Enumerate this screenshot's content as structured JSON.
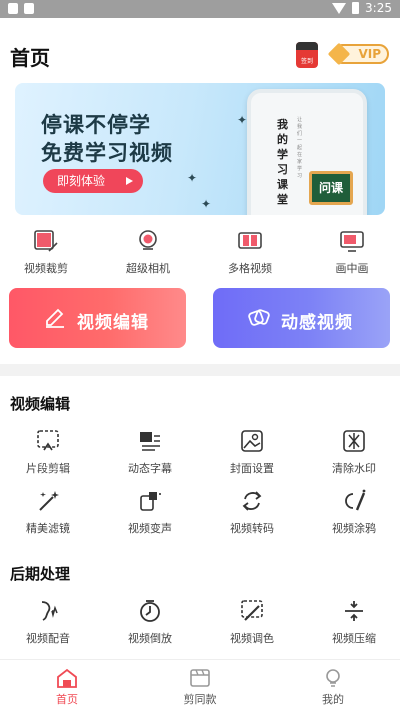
{
  "status_bar": {
    "time": "3:25"
  },
  "header": {
    "title": "首页",
    "sign_label": "签到",
    "vip_label": "VIP"
  },
  "banner": {
    "headline": "停课不停学",
    "subline": "免费学习视频",
    "cta": "即刻体验",
    "phone_text": "我的学习课堂",
    "phone_sub": "让我们一起在家学习",
    "board_text": "问课"
  },
  "features": [
    {
      "label": "视频裁剪",
      "icon": "crop-icon"
    },
    {
      "label": "超级相机",
      "icon": "camera-icon"
    },
    {
      "label": "多格视频",
      "icon": "grid-video-icon"
    },
    {
      "label": "画中画",
      "icon": "picture-in-picture-icon"
    }
  ],
  "big_buttons": {
    "edit": {
      "label": "视频编辑",
      "icon": "pen-icon"
    },
    "motion": {
      "label": "动感视频",
      "icon": "motion-icon"
    }
  },
  "sections": {
    "video_edit": {
      "title": "视频编辑",
      "tools": [
        {
          "label": "片段剪辑",
          "icon": "clip-icon"
        },
        {
          "label": "动态字幕",
          "icon": "subtitle-icon"
        },
        {
          "label": "封面设置",
          "icon": "cover-icon"
        },
        {
          "label": "清除水印",
          "icon": "watermark-icon"
        },
        {
          "label": "精美滤镜",
          "icon": "filter-icon"
        },
        {
          "label": "视频变声",
          "icon": "voice-change-icon"
        },
        {
          "label": "视频转码",
          "icon": "transcode-icon"
        },
        {
          "label": "视频涂鸦",
          "icon": "doodle-icon"
        }
      ]
    },
    "post_processing": {
      "title": "后期处理",
      "tools": [
        {
          "label": "视频配音",
          "icon": "dubbing-icon"
        },
        {
          "label": "视频倒放",
          "icon": "reverse-icon"
        },
        {
          "label": "视频调色",
          "icon": "color-grade-icon"
        },
        {
          "label": "视频压缩",
          "icon": "compress-icon"
        }
      ]
    }
  },
  "tabbar": [
    {
      "label": "首页",
      "icon": "home-icon",
      "active": true
    },
    {
      "label": "剪同款",
      "icon": "template-icon",
      "active": false
    },
    {
      "label": "我的",
      "icon": "profile-icon",
      "active": false
    }
  ],
  "colors": {
    "accent_red": "#f04b55",
    "edit_gradient_start": "#ff5867",
    "motion_gradient_start": "#6f6cf7",
    "vip_gold": "#e8a33a"
  }
}
